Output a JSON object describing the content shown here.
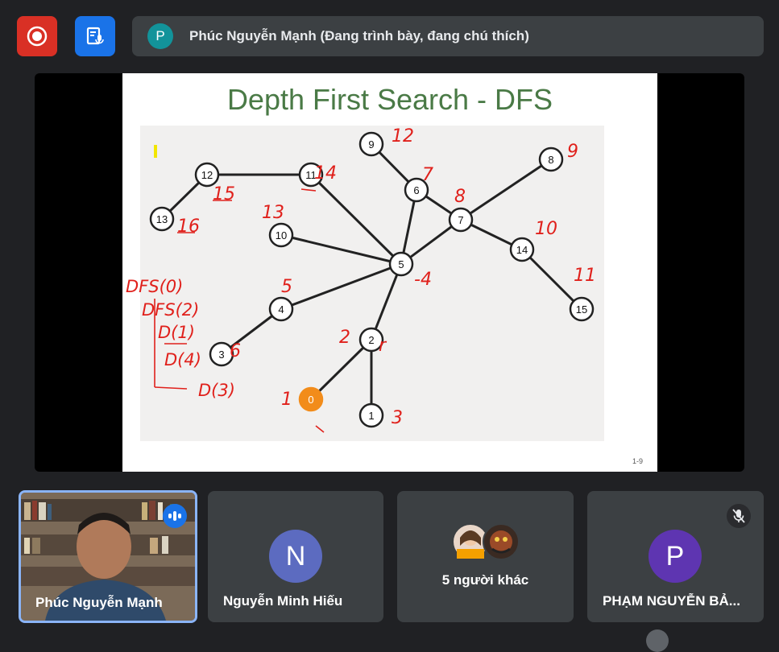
{
  "presenter": {
    "avatar_letter": "P",
    "text": "Phúc Nguyễn Mạnh (Đang trình bày, đang chú thích)"
  },
  "slide": {
    "title": "Depth First Search - DFS",
    "page_number": "1-9",
    "nodes": [
      {
        "id": "0",
        "highlight": true
      },
      {
        "id": "1"
      },
      {
        "id": "2"
      },
      {
        "id": "3"
      },
      {
        "id": "4"
      },
      {
        "id": "5"
      },
      {
        "id": "6"
      },
      {
        "id": "7"
      },
      {
        "id": "8"
      },
      {
        "id": "9"
      },
      {
        "id": "10"
      },
      {
        "id": "11"
      },
      {
        "id": "12"
      },
      {
        "id": "13"
      },
      {
        "id": "14"
      },
      {
        "id": "15"
      }
    ],
    "edges": [
      [
        "12",
        "11"
      ],
      [
        "12",
        "13"
      ],
      [
        "11",
        "5"
      ],
      [
        "10",
        "5"
      ],
      [
        "9",
        "6"
      ],
      [
        "6",
        "5"
      ],
      [
        "6",
        "7"
      ],
      [
        "7",
        "8"
      ],
      [
        "7",
        "5"
      ],
      [
        "7",
        "14"
      ],
      [
        "14",
        "15"
      ],
      [
        "5",
        "4"
      ],
      [
        "4",
        "3"
      ],
      [
        "5",
        "2"
      ],
      [
        "2",
        "0"
      ],
      [
        "2",
        "1"
      ]
    ],
    "annotations": [
      "12",
      "15",
      "16",
      "14",
      "7",
      "9",
      "8",
      "13",
      "10",
      "5",
      "-4",
      "11",
      "2",
      "6",
      "1",
      "3",
      "r"
    ],
    "handwritten_trace": [
      "DFS(0)",
      "DFS(2)",
      "D(1)",
      "D(4)",
      "D(3)"
    ]
  },
  "participants": [
    {
      "name": "Phúc Nguyễn Mạnh",
      "speaking": true
    },
    {
      "name": "Nguyễn Minh Hiếu",
      "avatar_letter": "N",
      "color": "#5c6bc0"
    },
    {
      "name": "5 người khác"
    },
    {
      "name": "PHẠM NGUYỄN BẢ...",
      "avatar_letter": "P",
      "color": "#5e35b1",
      "muted": true
    }
  ],
  "colors": {
    "record": "#d93025",
    "accent": "#1a73e8",
    "annotation": "#e0201b",
    "title_green": "#4a7a46"
  }
}
